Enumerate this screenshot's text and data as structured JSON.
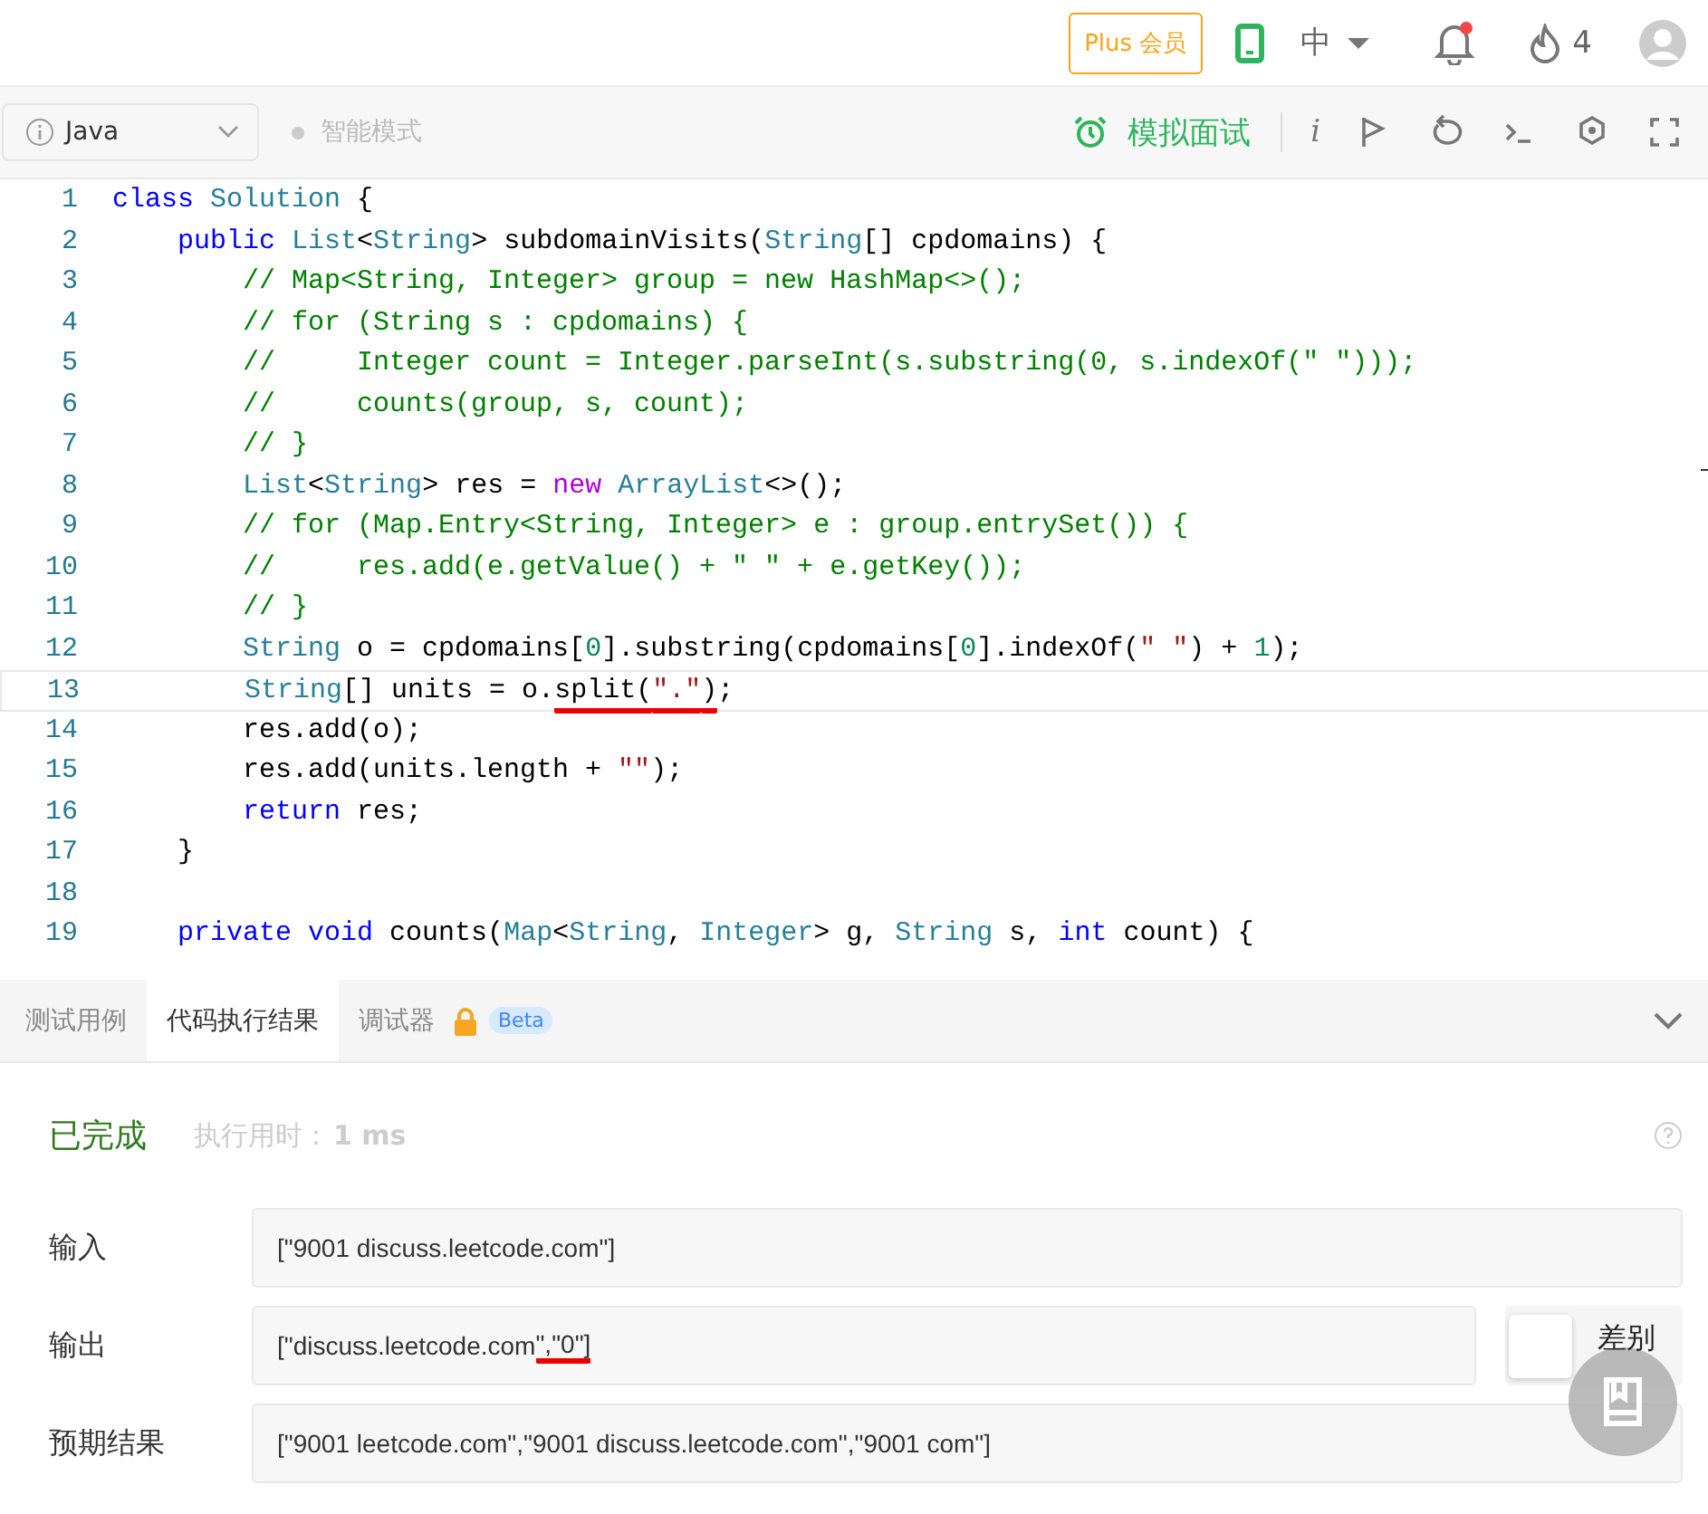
{
  "header": {
    "plus_button": "Plus 会员",
    "language": "中",
    "notification_unread": true,
    "streak": "4"
  },
  "toolbar": {
    "language_select": "Java",
    "mode": "智能模式",
    "interview_button": "模拟面试",
    "info_button": "i"
  },
  "editor": {
    "lines": [
      {
        "number": "1",
        "current": false,
        "tokens": [
          {
            "kind": "kw",
            "text": "class"
          },
          {
            "kind": "type",
            "text": " Solution"
          },
          {
            "kind": "plain",
            "text": " {"
          }
        ]
      },
      {
        "number": "2",
        "current": false,
        "tokens": [
          {
            "kind": "kw",
            "text": "    public"
          },
          {
            "kind": "type",
            "text": " List"
          },
          {
            "kind": "plain",
            "text": "<"
          },
          {
            "kind": "type",
            "text": "String"
          },
          {
            "kind": "plain",
            "text": "> subdomainVisits("
          },
          {
            "kind": "type",
            "text": "String"
          },
          {
            "kind": "plain",
            "text": "[] cpdomains) {"
          }
        ]
      },
      {
        "number": "3",
        "current": false,
        "tokens": [
          {
            "kind": "comment",
            "text": "        // Map<String, Integer> group = new HashMap<>();"
          }
        ]
      },
      {
        "number": "4",
        "current": false,
        "tokens": [
          {
            "kind": "comment",
            "text": "        // for (String s : cpdomains) {"
          }
        ]
      },
      {
        "number": "5",
        "current": false,
        "tokens": [
          {
            "kind": "comment",
            "text": "        //     Integer count = Integer.parseInt(s.substring(0, s.indexOf(\" \")));"
          }
        ]
      },
      {
        "number": "6",
        "current": false,
        "tokens": [
          {
            "kind": "comment",
            "text": "        //     counts(group, s, count);"
          }
        ]
      },
      {
        "number": "7",
        "current": false,
        "tokens": [
          {
            "kind": "comment",
            "text": "        // }"
          }
        ]
      },
      {
        "number": "8",
        "current": false,
        "tokens": [
          {
            "kind": "type",
            "text": "        List"
          },
          {
            "kind": "plain",
            "text": "<"
          },
          {
            "kind": "type",
            "text": "String"
          },
          {
            "kind": "plain",
            "text": "> res = "
          },
          {
            "kind": "new",
            "text": "new"
          },
          {
            "kind": "type",
            "text": " ArrayList"
          },
          {
            "kind": "plain",
            "text": "<>();"
          }
        ]
      },
      {
        "number": "9",
        "current": false,
        "tokens": [
          {
            "kind": "comment",
            "text": "        // for (Map.Entry<String, Integer> e : group.entrySet()) {"
          }
        ]
      },
      {
        "number": "10",
        "current": false,
        "tokens": [
          {
            "kind": "comment",
            "text": "        //     res.add(e.getValue() + \" \" + e.getKey());"
          }
        ]
      },
      {
        "number": "11",
        "current": false,
        "tokens": [
          {
            "kind": "comment",
            "text": "        // }"
          }
        ]
      },
      {
        "number": "12",
        "current": false,
        "tokens": [
          {
            "kind": "type",
            "text": "        String"
          },
          {
            "kind": "plain",
            "text": " o = cpdomains["
          },
          {
            "kind": "num",
            "text": "0"
          },
          {
            "kind": "plain",
            "text": "].substring(cpdomains["
          },
          {
            "kind": "num",
            "text": "0"
          },
          {
            "kind": "plain",
            "text": "].indexOf("
          },
          {
            "kind": "str",
            "text": "\" \""
          },
          {
            "kind": "plain",
            "text": ") + "
          },
          {
            "kind": "num",
            "text": "1"
          },
          {
            "kind": "plain",
            "text": ");"
          }
        ]
      },
      {
        "number": "13",
        "current": true,
        "tokens": [
          {
            "kind": "type",
            "text": "        String"
          },
          {
            "kind": "plain",
            "text": "[] units = o."
          },
          {
            "kind": "plain",
            "text": "split(",
            "marked": true
          },
          {
            "kind": "str",
            "text": "\".\"",
            "marked": true
          },
          {
            "kind": "plain",
            "text": ")",
            "marked": true
          },
          {
            "kind": "plain",
            "text": ";"
          }
        ]
      },
      {
        "number": "14",
        "current": false,
        "tokens": [
          {
            "kind": "plain",
            "text": "        res.add(o);"
          }
        ]
      },
      {
        "number": "15",
        "current": false,
        "tokens": [
          {
            "kind": "plain",
            "text": "        res.add(units.length + "
          },
          {
            "kind": "str",
            "text": "\"\""
          },
          {
            "kind": "plain",
            "text": ");"
          }
        ]
      },
      {
        "number": "16",
        "current": false,
        "tokens": [
          {
            "kind": "kw",
            "text": "        return"
          },
          {
            "kind": "plain",
            "text": " res;"
          }
        ]
      },
      {
        "number": "17",
        "current": false,
        "tokens": [
          {
            "kind": "plain",
            "text": "    }"
          }
        ]
      },
      {
        "number": "18",
        "current": false
      },
      {
        "number": "19",
        "current": false,
        "tokens": [
          {
            "kind": "kw",
            "text": "    private"
          },
          {
            "kind": "kw",
            "text": " void"
          },
          {
            "kind": "plain",
            "text": " counts("
          },
          {
            "kind": "type",
            "text": "Map"
          },
          {
            "kind": "plain",
            "text": "<"
          },
          {
            "kind": "type",
            "text": "String"
          },
          {
            "kind": "plain",
            "text": ", "
          },
          {
            "kind": "type",
            "text": "Integer"
          },
          {
            "kind": "plain",
            "text": "> g, "
          },
          {
            "kind": "type",
            "text": "String"
          },
          {
            "kind": "plain",
            "text": " s, "
          },
          {
            "kind": "kw",
            "text": "int"
          },
          {
            "kind": "plain",
            "text": " count) {"
          }
        ]
      }
    ]
  },
  "panel": {
    "tabs": [
      {
        "label": "测试用例",
        "selected": false
      },
      {
        "label": "代码执行结果",
        "selected": true
      },
      {
        "label": "调试器",
        "selected": false,
        "locked": true,
        "badge": "Beta"
      }
    ],
    "status": "已完成",
    "runtime_label": "执行用时：",
    "runtime": "1 ms",
    "rows": [
      {
        "kind": "plain",
        "label": "输入",
        "segments": [
          {
            "text": "[\"9001 discuss.leetcode.com\"]",
            "marked": false
          }
        ]
      },
      {
        "kind": "diff",
        "label": "输出",
        "segments": [
          {
            "text": "[\"discuss.leetcode.com",
            "marked": false
          },
          {
            "text": "\",\"0\"]",
            "marked": true
          }
        ],
        "toggle_label": "差别",
        "toggle_on": false
      },
      {
        "kind": "plain",
        "label": "预期结果",
        "segments": [
          {
            "text": "[\"9001 leetcode.com\",\"9001 discuss.leetcode.com\",\"9001 com\"]",
            "marked": false
          }
        ]
      }
    ]
  }
}
